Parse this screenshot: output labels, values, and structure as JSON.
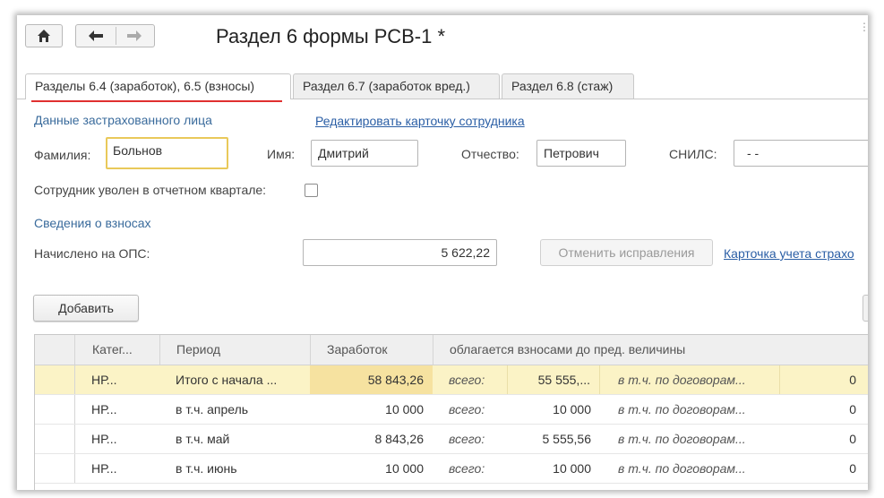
{
  "window": {
    "title": "Раздел 6 формы РСВ-1 *",
    "more_glyph": "⋮"
  },
  "toolbar": {
    "home_icon": "home-icon",
    "back_icon": "arrow-left-icon",
    "forward_icon": "arrow-right-icon"
  },
  "tabs": [
    {
      "label": "Разделы 6.4 (заработок), 6.5 (взносы)",
      "active": true
    },
    {
      "label": "Раздел 6.7 (заработок вред.)",
      "active": false
    },
    {
      "label": "Раздел 6.8 (стаж)",
      "active": false
    }
  ],
  "insured": {
    "section_title": "Данные застрахованного лица",
    "edit_link": "Редактировать карточку сотрудника",
    "surname_label": "Фамилия:",
    "surname_value": "Больнов",
    "name_label": "Имя:",
    "name_value": "Дмитрий",
    "patronymic_label": "Отчество:",
    "patronymic_value": "Петрович",
    "snils_label": "СНИЛС:",
    "snils_value": " -  -",
    "dismissed_label": "Сотрудник уволен в отчетном квартале:",
    "dismissed_checked": false
  },
  "contributions": {
    "section_title": "Сведения о взносах",
    "ops_label": "Начислено на ОПС:",
    "ops_value": "5 622,22",
    "cancel_button": "Отменить исправления",
    "card_link": "Карточка учета страхо"
  },
  "add_button": "Добавить",
  "table": {
    "columns": [
      "Катег...",
      "Период",
      "Заработок",
      "облагается взносами до пред. величины"
    ],
    "rows": [
      {
        "category": "НР...",
        "period": "Итого с начала ...",
        "earnings": "58 843,26",
        "total_label": "всего:",
        "total": "55 555,...",
        "contracts_label": "в т.ч. по договорам...",
        "contracts": "0",
        "selected": true
      },
      {
        "category": "НР...",
        "period": "в т.ч. апрель",
        "earnings": "10 000",
        "total_label": "всего:",
        "total": "10 000",
        "contracts_label": "в т.ч. по договорам...",
        "contracts": "0",
        "selected": false
      },
      {
        "category": "НР...",
        "period": "в т.ч. май",
        "earnings": "8 843,26",
        "total_label": "всего:",
        "total": "5 555,56",
        "contracts_label": "в т.ч. по договорам...",
        "contracts": "0",
        "selected": false
      },
      {
        "category": "НР...",
        "period": "в т.ч. июнь",
        "earnings": "10 000",
        "total_label": "всего:",
        "total": "10 000",
        "contracts_label": "в т.ч. по договорам...",
        "contracts": "0",
        "selected": false
      }
    ]
  },
  "colors": {
    "accent_underline": "#e03030",
    "selected_row": "#fbf3c6",
    "link": "#2a5ea5",
    "section_title": "#3a6b9c",
    "focused_border": "#e9c95a"
  }
}
